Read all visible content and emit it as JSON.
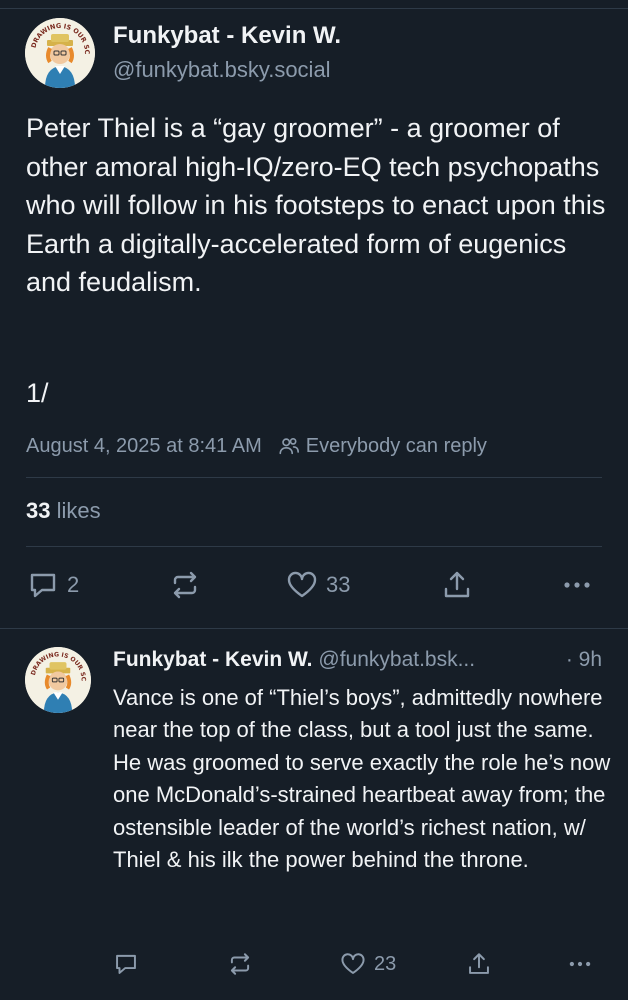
{
  "main_post": {
    "author_name": "Funkybat - Kevin W.",
    "author_handle": "@funkybat.bsky.social",
    "avatar_badge_text": "DRAWING IS OUR SCOPE",
    "text": "Peter Thiel is a “gay groomer” - a groomer of other amoral high-IQ/zero-EQ tech psychopaths who will follow in his footsteps to enact upon this Earth a digitally-accelerated form of eugenics and feudalism.",
    "thread_index": "1/",
    "timestamp": "August 4, 2025 at 8:41 AM",
    "reply_setting": "Everybody can reply",
    "likes_count": "33",
    "likes_label": "likes",
    "actions": {
      "replies": "2",
      "likes": "33"
    }
  },
  "reply_post": {
    "author_name": "Funkybat - Kevin W.",
    "author_handle": "@funkybat.bsk...",
    "separator": " · ",
    "time": "9h",
    "text": "Vance is one of “Thiel’s boys”, admittedly nowhere near the top of the class, but a tool just the same. He was groomed to serve exactly the role he’s now one McDonald’s-strained heartbeat away from; the ostensible leader of the world’s richest nation, w/ Thiel & his ilk the power behind the throne.",
    "actions": {
      "likes": "23"
    }
  },
  "colors": {
    "background": "#161e27",
    "text_primary": "#f1f3f5",
    "text_secondary": "#8c9bac",
    "divider": "#2e3a47"
  },
  "icons": {
    "reply": "speech-bubble-icon",
    "repost": "repost-arrows-icon",
    "like": "heart-icon",
    "share": "share-upload-icon",
    "more": "more-dots-icon",
    "audience": "people-icon"
  }
}
